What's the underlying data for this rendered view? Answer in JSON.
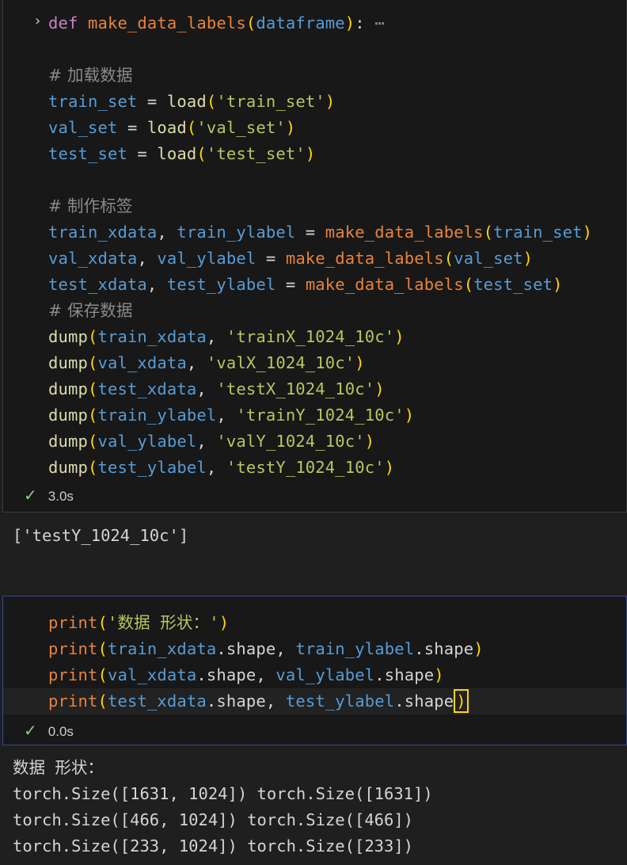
{
  "cell1": {
    "lines": [
      [
        [
          "kw",
          "def "
        ],
        [
          "fnc",
          "make_data_labels"
        ],
        [
          "p1",
          "("
        ],
        [
          "var",
          "dataframe"
        ],
        [
          "p1",
          ")"
        ],
        [
          "op",
          ":"
        ],
        [
          "ell",
          " ⋯"
        ]
      ],
      [],
      [
        [
          "cm",
          "# 加载数据"
        ]
      ],
      [
        [
          "var",
          "train_set"
        ],
        [
          "op",
          " = "
        ],
        [
          "fn",
          "load"
        ],
        [
          "p1",
          "("
        ],
        [
          "str2",
          "'train_set'"
        ],
        [
          "p1",
          ")"
        ]
      ],
      [
        [
          "var",
          "val_set"
        ],
        [
          "op",
          " = "
        ],
        [
          "fn",
          "load"
        ],
        [
          "p1",
          "("
        ],
        [
          "str2",
          "'val_set'"
        ],
        [
          "p1",
          ")"
        ]
      ],
      [
        [
          "var",
          "test_set"
        ],
        [
          "op",
          " = "
        ],
        [
          "fn",
          "load"
        ],
        [
          "p1",
          "("
        ],
        [
          "str2",
          "'test_set'"
        ],
        [
          "p1",
          ")"
        ]
      ],
      [],
      [
        [
          "cm",
          "# 制作标签"
        ]
      ],
      [
        [
          "var",
          "train_xdata"
        ],
        [
          "op",
          ", "
        ],
        [
          "var",
          "train_ylabel"
        ],
        [
          "op",
          " = "
        ],
        [
          "fnc",
          "make_data_labels"
        ],
        [
          "p1",
          "("
        ],
        [
          "var",
          "train_set"
        ],
        [
          "p1",
          ")"
        ]
      ],
      [
        [
          "var",
          "val_xdata"
        ],
        [
          "op",
          ", "
        ],
        [
          "var",
          "val_ylabel"
        ],
        [
          "op",
          " = "
        ],
        [
          "fnc",
          "make_data_labels"
        ],
        [
          "p1",
          "("
        ],
        [
          "var",
          "val_set"
        ],
        [
          "p1",
          ")"
        ]
      ],
      [
        [
          "var",
          "test_xdata"
        ],
        [
          "op",
          ", "
        ],
        [
          "var",
          "test_ylabel"
        ],
        [
          "op",
          " = "
        ],
        [
          "fnc",
          "make_data_labels"
        ],
        [
          "p1",
          "("
        ],
        [
          "var",
          "test_set"
        ],
        [
          "p1",
          ")"
        ]
      ],
      [
        [
          "cm",
          "# 保存数据"
        ]
      ],
      [
        [
          "fn",
          "dump"
        ],
        [
          "p1",
          "("
        ],
        [
          "var",
          "train_xdata"
        ],
        [
          "op",
          ", "
        ],
        [
          "str2",
          "'trainX_1024_10c'"
        ],
        [
          "p1",
          ")"
        ]
      ],
      [
        [
          "fn",
          "dump"
        ],
        [
          "p1",
          "("
        ],
        [
          "var",
          "val_xdata"
        ],
        [
          "op",
          ", "
        ],
        [
          "str2",
          "'valX_1024_10c'"
        ],
        [
          "p1",
          ")"
        ]
      ],
      [
        [
          "fn",
          "dump"
        ],
        [
          "p1",
          "("
        ],
        [
          "var",
          "test_xdata"
        ],
        [
          "op",
          ", "
        ],
        [
          "str2",
          "'testX_1024_10c'"
        ],
        [
          "p1",
          ")"
        ]
      ],
      [
        [
          "fn",
          "dump"
        ],
        [
          "p1",
          "("
        ],
        [
          "var",
          "train_ylabel"
        ],
        [
          "op",
          ", "
        ],
        [
          "str2",
          "'trainY_1024_10c'"
        ],
        [
          "p1",
          ")"
        ]
      ],
      [
        [
          "fn",
          "dump"
        ],
        [
          "p1",
          "("
        ],
        [
          "var",
          "val_ylabel"
        ],
        [
          "op",
          ", "
        ],
        [
          "str2",
          "'valY_1024_10c'"
        ],
        [
          "p1",
          ")"
        ]
      ],
      [
        [
          "fn",
          "dump"
        ],
        [
          "p1",
          "("
        ],
        [
          "var",
          "test_ylabel"
        ],
        [
          "op",
          ", "
        ],
        [
          "str2",
          "'testY_1024_10c'"
        ],
        [
          "p1",
          ")"
        ]
      ]
    ],
    "status_time": "3.0s",
    "output": "['testY_1024_10c']"
  },
  "cell2": {
    "lines": [
      [
        [
          "fnc",
          "print"
        ],
        [
          "p1",
          "("
        ],
        [
          "str2",
          "'数据 形状：'"
        ],
        [
          "p1",
          ")"
        ]
      ],
      [
        [
          "fnc",
          "print"
        ],
        [
          "p1",
          "("
        ],
        [
          "var",
          "train_xdata"
        ],
        [
          "op",
          "."
        ],
        [
          "plain",
          "shape"
        ],
        [
          "op",
          ", "
        ],
        [
          "var",
          "train_ylabel"
        ],
        [
          "op",
          "."
        ],
        [
          "plain",
          "shape"
        ],
        [
          "p1",
          ")"
        ]
      ],
      [
        [
          "fnc",
          "print"
        ],
        [
          "p1",
          "("
        ],
        [
          "var",
          "val_xdata"
        ],
        [
          "op",
          "."
        ],
        [
          "plain",
          "shape"
        ],
        [
          "op",
          ", "
        ],
        [
          "var",
          "val_ylabel"
        ],
        [
          "op",
          "."
        ],
        [
          "plain",
          "shape"
        ],
        [
          "p1",
          ")"
        ]
      ],
      [
        [
          "fnc",
          "print"
        ],
        [
          "p1box",
          "("
        ],
        [
          "var",
          "test_xdata"
        ],
        [
          "op",
          "."
        ],
        [
          "plain",
          "shape"
        ],
        [
          "op",
          ", "
        ],
        [
          "var",
          "test_ylabel"
        ],
        [
          "op",
          "."
        ],
        [
          "plain",
          "shape"
        ],
        [
          "p1box",
          ")"
        ]
      ]
    ],
    "status_time": "0.0s",
    "output": [
      "数据 形状：",
      "torch.Size([1631, 1024]) torch.Size([1631])",
      "torch.Size([466, 1024]) torch.Size([466])",
      "torch.Size([233, 1024]) torch.Size([233])"
    ]
  },
  "icons": {
    "fold": "chevron-right-icon",
    "success": "check-icon"
  },
  "colors": {
    "keyword": "#c586c0",
    "function": "#dcdcaa",
    "variable": "#569cd6",
    "string": "#b5c760",
    "bracket": "#ffd700",
    "success": "#89d185"
  }
}
